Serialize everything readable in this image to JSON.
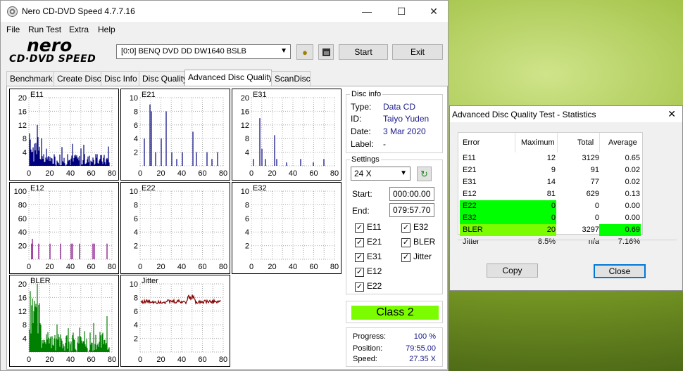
{
  "main": {
    "title": "Nero CD-DVD Speed 4.7.7.16",
    "menu": [
      "File",
      "Run Test",
      "Extra",
      "Help"
    ],
    "logo_top": "nero",
    "logo_bottom": "CD·DVD SPEED",
    "drive": "[0:0]   BENQ DVD DD DW1640 BSLB",
    "start_label": "Start",
    "exit_label": "Exit",
    "tabs": [
      "Benchmark",
      "Create Disc",
      "Disc Info",
      "Disc Quality",
      "Advanced Disc Quality",
      "ScanDisc"
    ],
    "active_tab": "Advanced Disc Quality"
  },
  "charts": [
    {
      "label": "E11",
      "yticks": [
        "20",
        "16",
        "12",
        "8",
        "4"
      ],
      "ymax": 20,
      "color": "#00007f"
    },
    {
      "label": "E21",
      "yticks": [
        "10",
        "8",
        "6",
        "4",
        "2"
      ],
      "ymax": 10,
      "color": "#00007f"
    },
    {
      "label": "E31",
      "yticks": [
        "20",
        "16",
        "12",
        "8",
        "4"
      ],
      "ymax": 20,
      "color": "#00007f"
    },
    {
      "label": "E12",
      "yticks": [
        "100",
        "80",
        "60",
        "40",
        "20"
      ],
      "ymax": 100,
      "color": "#800080"
    },
    {
      "label": "E22",
      "yticks": [
        "10",
        "8",
        "6",
        "4",
        "2"
      ],
      "ymax": 10,
      "color": "#00007f"
    },
    {
      "label": "E32",
      "yticks": [
        "10",
        "8",
        "6",
        "4",
        "2"
      ],
      "ymax": 10,
      "color": "#00007f"
    },
    {
      "label": "BLER",
      "yticks": [
        "20",
        "16",
        "12",
        "8",
        "4"
      ],
      "ymax": 20,
      "color": "#008000"
    },
    {
      "label": "Jitter",
      "yticks": [
        "10",
        "8",
        "6",
        "4",
        "2"
      ],
      "ymax": 10,
      "color": "#800000"
    }
  ],
  "xticks": [
    "0",
    "20",
    "40",
    "60",
    "80"
  ],
  "chart_data": [
    {
      "type": "bar",
      "title": "E11",
      "x_range": [
        0,
        80
      ],
      "ylim": [
        0,
        20
      ],
      "description_values": "peak 12, dense low errors across disc"
    },
    {
      "type": "bar",
      "title": "E21",
      "x_range": [
        0,
        80
      ],
      "ylim": [
        0,
        10
      ],
      "values_peak": 9
    },
    {
      "type": "bar",
      "title": "E31",
      "x_range": [
        0,
        80
      ],
      "ylim": [
        0,
        20
      ],
      "values_peak": 14
    },
    {
      "type": "bar",
      "title": "E12",
      "x_range": [
        0,
        80
      ],
      "ylim": [
        0,
        100
      ],
      "values_peak": 81
    },
    {
      "type": "bar",
      "title": "E22",
      "x_range": [
        0,
        80
      ],
      "ylim": [
        0,
        10
      ],
      "values_peak": 0
    },
    {
      "type": "bar",
      "title": "E32",
      "x_range": [
        0,
        80
      ],
      "ylim": [
        0,
        10
      ],
      "values_peak": 0
    },
    {
      "type": "bar",
      "title": "BLER",
      "x_range": [
        0,
        80
      ],
      "ylim": [
        0,
        20
      ],
      "values_peak": 20
    },
    {
      "type": "line",
      "title": "Jitter",
      "x_range": [
        0,
        80
      ],
      "ylim": [
        0,
        10
      ],
      "values_peak": 8.5,
      "average": 7.16
    }
  ],
  "disc_info": {
    "legend": "Disc info",
    "type_label": "Type:",
    "type": "Data CD",
    "id_label": "ID:",
    "id": "Taiyo Yuden",
    "date_label": "Date:",
    "date": "3 Mar 2020",
    "label_label": "Label:",
    "label": "-"
  },
  "settings": {
    "legend": "Settings",
    "speed": "24 X",
    "start_label": "Start:",
    "start": "000:00.00",
    "end_label": "End:",
    "end": "079:57.70",
    "checks": [
      {
        "label": "E11",
        "checked": true
      },
      {
        "label": "E32",
        "checked": true
      },
      {
        "label": "E21",
        "checked": true
      },
      {
        "label": "BLER",
        "checked": true
      },
      {
        "label": "E31",
        "checked": true
      },
      {
        "label": "Jitter",
        "checked": true
      },
      {
        "label": "E12",
        "checked": true
      },
      {
        "label": "E22",
        "checked": true
      }
    ]
  },
  "class_label": "Class 2",
  "progress": {
    "progress_label": "Progress:",
    "progress": "100 %",
    "position_label": "Position:",
    "position": "79:55.00",
    "speed_label": "Speed:",
    "speed": "27.35 X"
  },
  "stats": {
    "title": "Advanced Disc Quality Test - Statistics",
    "headers": [
      "Error",
      "Maximum",
      "Total",
      "Average"
    ],
    "rows": [
      [
        "E11",
        "12",
        "3129",
        "0.65"
      ],
      [
        "E21",
        "9",
        "91",
        "0.02"
      ],
      [
        "E31",
        "14",
        "77",
        "0.02"
      ],
      [
        "E12",
        "81",
        "629",
        "0.13"
      ],
      [
        "E22",
        "0",
        "0",
        "0.00"
      ],
      [
        "E32",
        "0",
        "0",
        "0.00"
      ],
      [
        "BLER",
        "20",
        "3297",
        "0.69"
      ],
      [
        "Jitter",
        "8.5%",
        "n/a",
        "7.16%"
      ]
    ],
    "copy_label": "Copy",
    "close_label": "Close"
  }
}
